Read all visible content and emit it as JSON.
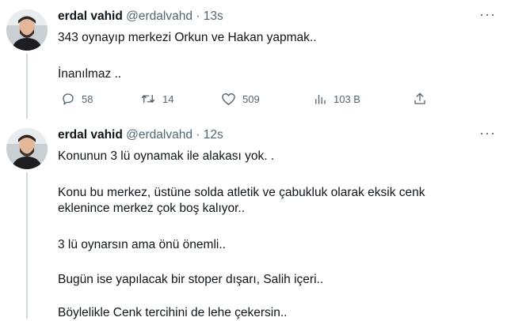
{
  "tweets": [
    {
      "author_name": "erdal vahid",
      "handle": "@erdalvahd",
      "separator": "·",
      "time": "13s",
      "more_label": "···",
      "lines": [
        "343 oynayıp merkezi Orkun ve Hakan yapmak..",
        "İnanılmaz .."
      ],
      "actions": {
        "replies": "58",
        "retweets": "14",
        "likes": "509",
        "views": "103 B"
      }
    },
    {
      "author_name": "erdal vahid",
      "handle": "@erdalvahd",
      "separator": "·",
      "time": "12s",
      "more_label": "···",
      "lines": [
        "Konunun 3 lü oynamak ile alakası yok. .",
        "Konu bu merkez, üstüne solda atletik ve çabukluk olarak eksik cenk",
        "eklenince merkez çok boş kalıyor..",
        "3 lü oynarsın ama önü önemli..",
        "Bugün ise yapılacak bir stoper dışarı, Salih içeri..",
        "Böylelikle Cenk tercihini de lehe çekersin.."
      ]
    }
  ],
  "colors": {
    "text": "#0f1419",
    "secondary": "#536471",
    "thread_line": "#cfd9de"
  }
}
